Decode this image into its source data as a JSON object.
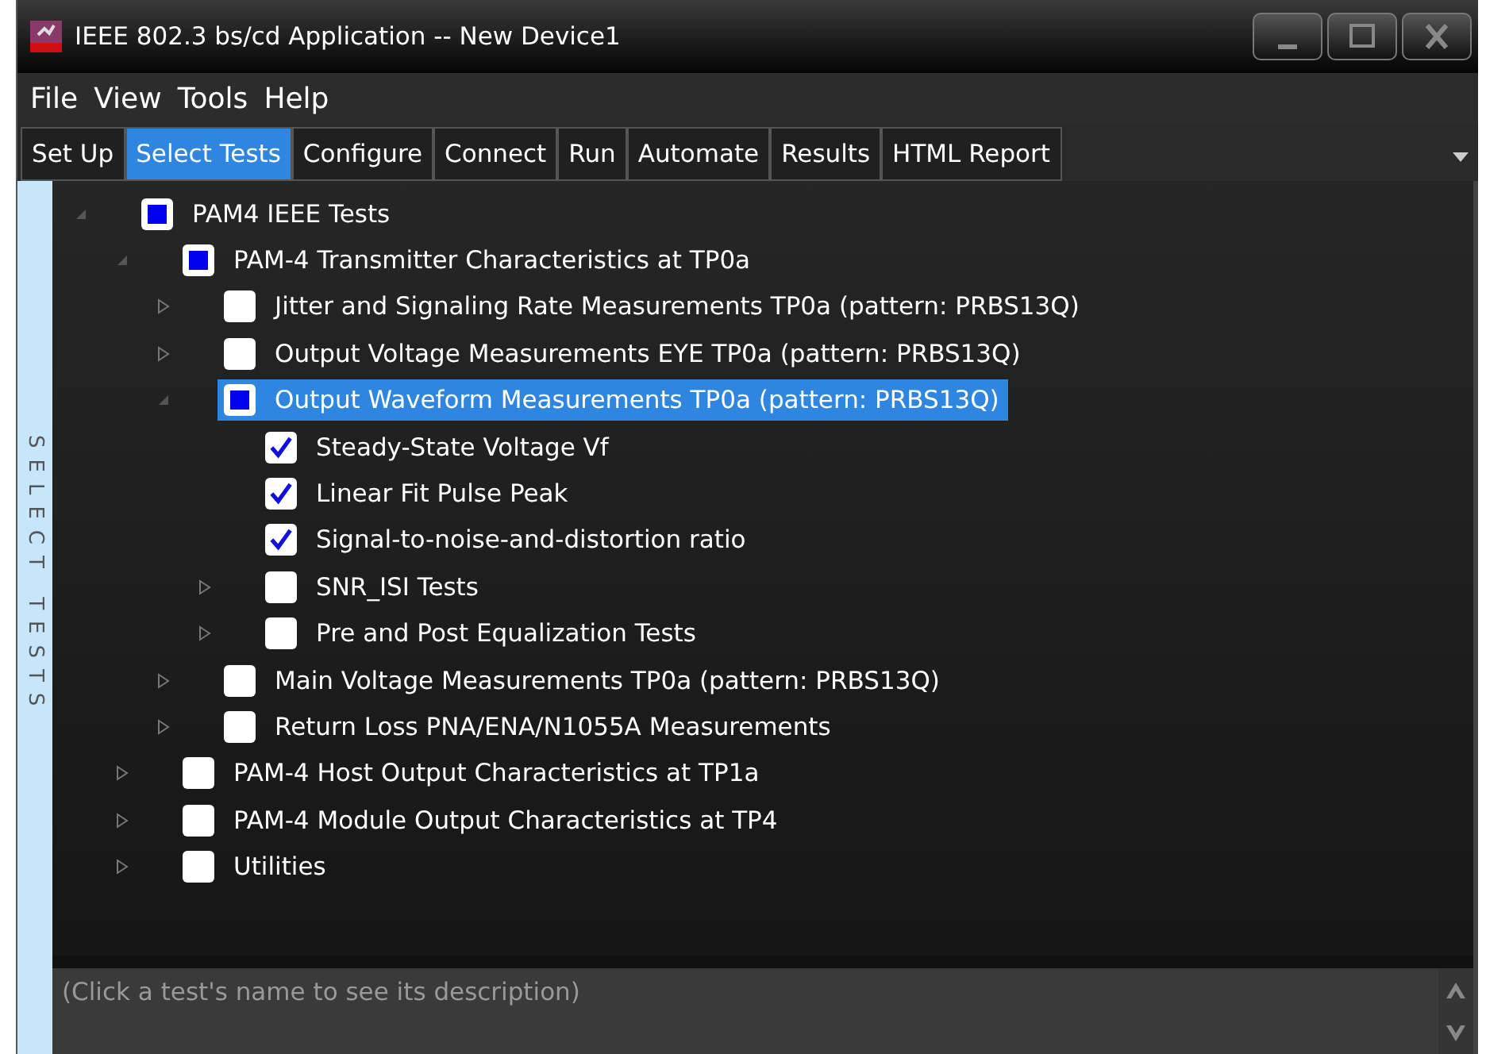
{
  "window": {
    "title": "IEEE 802.3 bs/cd Application -- New Device1"
  },
  "menu": [
    "File",
    "View",
    "Tools",
    "Help"
  ],
  "tabs": [
    {
      "label": "Set Up",
      "selected": false
    },
    {
      "label": "Select Tests",
      "selected": true
    },
    {
      "label": "Configure",
      "selected": false
    },
    {
      "label": "Connect",
      "selected": false
    },
    {
      "label": "Run",
      "selected": false
    },
    {
      "label": "Automate",
      "selected": false
    },
    {
      "label": "Results",
      "selected": false
    },
    {
      "label": "HTML Report",
      "selected": false
    }
  ],
  "sidebar": {
    "label": "SELECT TESTS"
  },
  "tree": [
    {
      "label": "PAM4 IEEE Tests",
      "checked": false,
      "partial": true,
      "expanded": true,
      "selected": false,
      "children": [
        {
          "label": "PAM-4 Transmitter Characteristics at TP0a",
          "checked": false,
          "partial": true,
          "expanded": true,
          "selected": false,
          "children": [
            {
              "label": "Jitter and Signaling Rate Measurements TP0a (pattern: PRBS13Q)",
              "checked": false,
              "partial": false,
              "expanded": false,
              "selected": false
            },
            {
              "label": "Output Voltage Measurements EYE TP0a (pattern: PRBS13Q)",
              "checked": false,
              "partial": false,
              "expanded": false,
              "selected": false
            },
            {
              "label": "Output Waveform Measurements TP0a (pattern: PRBS13Q)",
              "checked": false,
              "partial": true,
              "expanded": true,
              "selected": true,
              "children": [
                {
                  "label": "Steady-State Voltage Vf",
                  "checked": true,
                  "partial": false,
                  "selected": false
                },
                {
                  "label": "Linear Fit Pulse Peak",
                  "checked": true,
                  "partial": false,
                  "selected": false
                },
                {
                  "label": "Signal-to-noise-and-distortion ratio",
                  "checked": true,
                  "partial": false,
                  "selected": false
                },
                {
                  "label": "SNR_ISI Tests",
                  "checked": false,
                  "partial": false,
                  "expanded": false,
                  "selected": false
                },
                {
                  "label": "Pre and Post Equalization Tests",
                  "checked": false,
                  "partial": false,
                  "expanded": false,
                  "selected": false
                }
              ]
            },
            {
              "label": "Main Voltage Measurements TP0a (pattern: PRBS13Q)",
              "checked": false,
              "partial": false,
              "expanded": false,
              "selected": false
            },
            {
              "label": "Return Loss PNA/ENA/N1055A Measurements",
              "checked": false,
              "partial": false,
              "expanded": false,
              "selected": false
            }
          ]
        },
        {
          "label": "PAM-4 Host Output Characteristics at TP1a",
          "checked": false,
          "partial": false,
          "expanded": false,
          "selected": false
        },
        {
          "label": "PAM-4 Module Output Characteristics at TP4",
          "checked": false,
          "partial": false,
          "expanded": false,
          "selected": false
        },
        {
          "label": "Utilities",
          "checked": false,
          "partial": false,
          "expanded": false,
          "selected": false
        }
      ]
    }
  ],
  "description": {
    "text": "(Click a test's name to see its description)"
  }
}
